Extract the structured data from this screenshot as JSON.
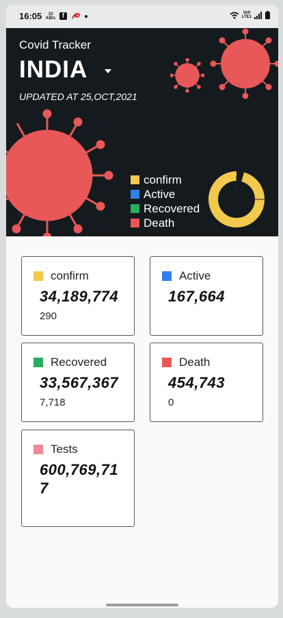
{
  "status_bar": {
    "time": "16:05",
    "speed_value": "33",
    "speed_unit": "KB/s",
    "volte_top": "Vo0",
    "volte_bottom": "LTE1"
  },
  "header": {
    "app_title": "Covid Tracker",
    "country": "INDIA",
    "updated": "UPDATED AT 25,OCT,2021"
  },
  "legend": [
    {
      "label": "confirm",
      "color": "#f2c94c"
    },
    {
      "label": "Active",
      "color": "#2f80ed"
    },
    {
      "label": "Recovered",
      "color": "#27ae60"
    },
    {
      "label": "Death",
      "color": "#eb5757"
    }
  ],
  "cards": {
    "confirm": {
      "label": "confirm",
      "value": "34,189,774",
      "delta": "290",
      "color": "#f2c94c"
    },
    "active": {
      "label": "Active",
      "value": "167,664",
      "delta": "",
      "color": "#2f80ed"
    },
    "recovered": {
      "label": "Recovered",
      "value": "33,567,367",
      "delta": "7,718",
      "color": "#27ae60"
    },
    "death": {
      "label": "Death",
      "value": "454,743",
      "delta": "0",
      "color": "#eb5757"
    },
    "tests": {
      "label": "Tests",
      "value_line1": "600,769,71",
      "value_line2": "7",
      "color": "#ee8a99"
    }
  },
  "colors": {
    "hero_bg": "#151a1e",
    "virus": "#e85858"
  }
}
